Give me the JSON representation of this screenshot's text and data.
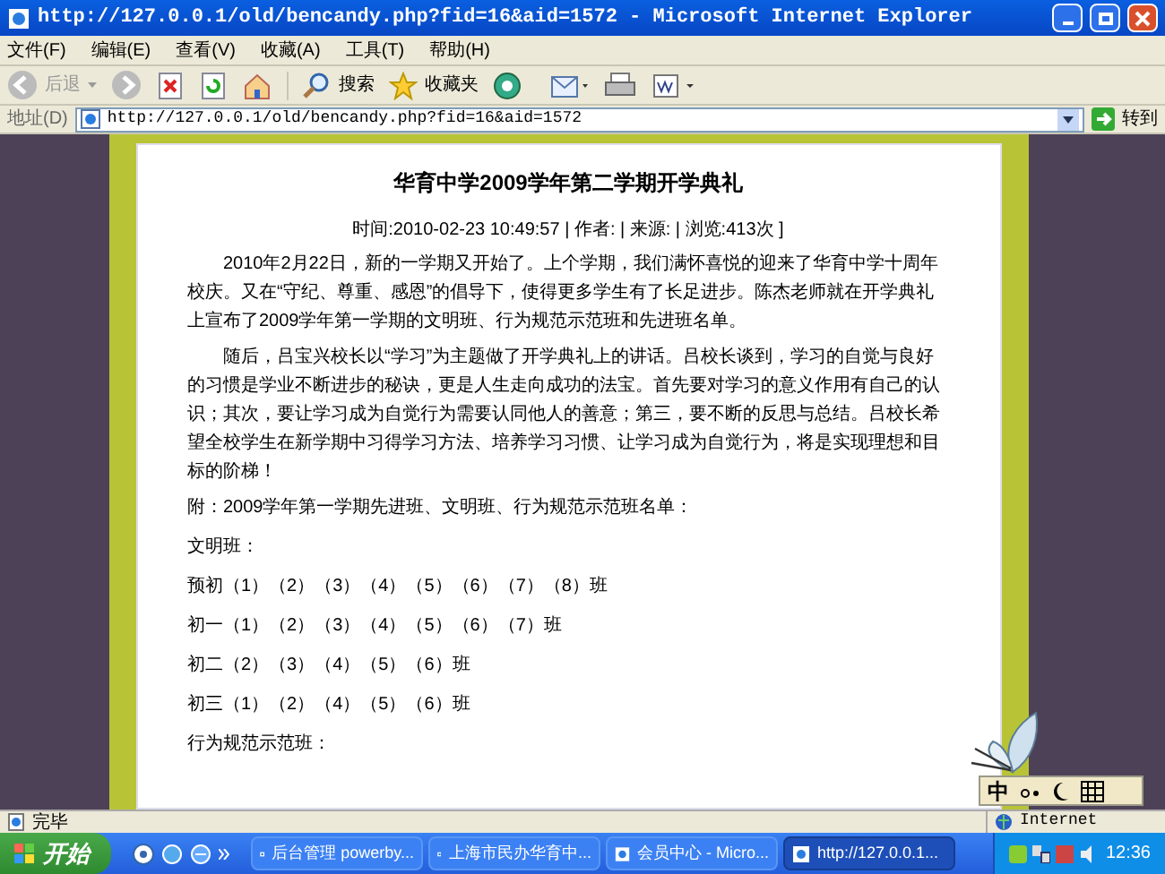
{
  "window": {
    "title": "http://127.0.0.1/old/bencandy.php?fid=16&aid=1572 - Microsoft Internet Explorer"
  },
  "menu": [
    "文件(F)",
    "编辑(E)",
    "查看(V)",
    "收藏(A)",
    "工具(T)",
    "帮助(H)"
  ],
  "toolbar": {
    "back": "后退",
    "search": "搜索",
    "favorites": "收藏夹"
  },
  "address_bar": {
    "label": "地址(D)",
    "url": "http://127.0.0.1/old/bencandy.php?fid=16&aid=1572",
    "go": "转到"
  },
  "article": {
    "title": "华育中学2009学年第二学期开学典礼",
    "meta": "时间:2010-02-23 10:49:57 | 作者: | 来源: | 浏览:413次 ]",
    "paragraphs": [
      {
        "kind": "indented",
        "text": "2010年2月22日，新的一学期又开始了。上个学期，我们满怀喜悦的迎来了华育中学十周年校庆。又在“守纪、尊重、感恩”的倡导下，使得更多学生有了长足进步。陈杰老师就在开学典礼上宣布了2009学年第一学期的文明班、行为规范示范班和先进班名单。"
      },
      {
        "kind": "indented",
        "text": "随后，吕宝兴校长以“学习”为主题做了开学典礼上的讲话。吕校长谈到，学习的自觉与良好的习惯是学业不断进步的秘诀，更是人生走向成功的法宝。首先要对学习的意义作用有自己的认识；其次，要让学习成为自觉行为需要认同他人的善意；第三，要不断的反思与总结。吕校长希望全校学生在新学期中习得学习方法、培养学习习惯、让学习成为自觉行为，将是实现理想和目标的阶梯！"
      },
      {
        "kind": "plain",
        "text": "附：2009学年第一学期先进班、文明班、行为规范示范班名单："
      },
      {
        "kind": "plain",
        "text": "文明班："
      },
      {
        "kind": "plain",
        "text": "预初（1）（2）（3）（4）（5）（6）（7）（8）班"
      },
      {
        "kind": "plain",
        "text": "初一（1）（2）（3）（4）（5）（6）（7）班"
      },
      {
        "kind": "plain",
        "text": "初二（2）（3）（4）（5）（6）班"
      },
      {
        "kind": "plain",
        "text": "初三（1）（2）（4）（5）（6）班"
      },
      {
        "kind": "plain",
        "text": "行为规范示范班："
      }
    ]
  },
  "ime_bar": {
    "mode": "中"
  },
  "status_bar": {
    "text": "完毕",
    "zone": "Internet"
  },
  "taskbar": {
    "start": "开始",
    "tasks": [
      {
        "label": "后台管理 powerby...",
        "selected": false
      },
      {
        "label": "上海市民办华育中...",
        "selected": false
      },
      {
        "label": "会员中心 - Micro...",
        "selected": false
      },
      {
        "label": "http://127.0.0.1...",
        "selected": true
      }
    ],
    "clock": "12:36"
  }
}
